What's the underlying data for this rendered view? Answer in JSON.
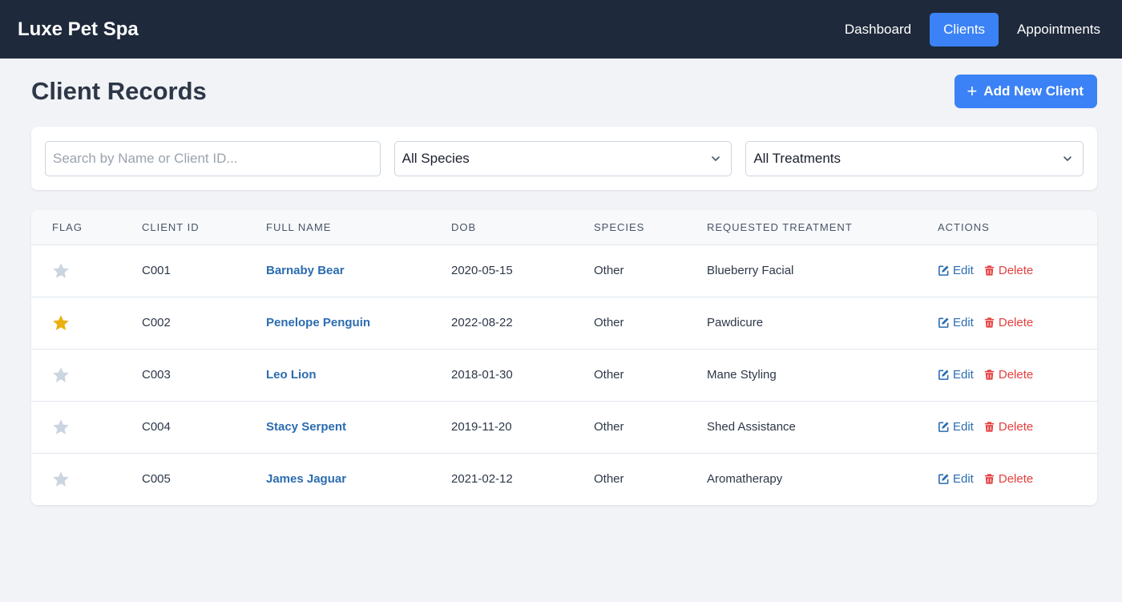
{
  "navbar": {
    "brand": "Luxe Pet Spa",
    "links": [
      {
        "label": "Dashboard",
        "active": false
      },
      {
        "label": "Clients",
        "active": true
      },
      {
        "label": "Appointments",
        "active": false
      }
    ]
  },
  "page": {
    "title": "Client Records",
    "add_button_label": "Add New Client"
  },
  "filters": {
    "search_placeholder": "Search by Name or Client ID...",
    "search_value": "",
    "species_selected": "All Species",
    "treatment_selected": "All Treatments"
  },
  "table": {
    "headers": {
      "flag": "FLAG",
      "client_id": "CLIENT ID",
      "full_name": "FULL NAME",
      "dob": "DOB",
      "species": "SPECIES",
      "treatment": "REQUESTED TREATMENT",
      "actions": "ACTIONS"
    },
    "edit_label": "Edit",
    "delete_label": "Delete",
    "rows": [
      {
        "flagged": false,
        "id": "C001",
        "name": "Barnaby Bear",
        "dob": "2020-05-15",
        "species": "Other",
        "treatment": "Blueberry Facial"
      },
      {
        "flagged": true,
        "id": "C002",
        "name": "Penelope Penguin",
        "dob": "2022-08-22",
        "species": "Other",
        "treatment": "Pawdicure"
      },
      {
        "flagged": false,
        "id": "C003",
        "name": "Leo Lion",
        "dob": "2018-01-30",
        "species": "Other",
        "treatment": "Mane Styling"
      },
      {
        "flagged": false,
        "id": "C004",
        "name": "Stacy Serpent",
        "dob": "2019-11-20",
        "species": "Other",
        "treatment": "Shed Assistance"
      },
      {
        "flagged": false,
        "id": "C005",
        "name": "James Jaguar",
        "dob": "2021-02-12",
        "species": "Other",
        "treatment": "Aromatherapy"
      }
    ]
  },
  "colors": {
    "navbar_bg": "#1e293b",
    "accent": "#3b82f6",
    "link": "#2b6cb0",
    "danger": "#e53e3e",
    "star_active": "#ecb00e",
    "star_inactive": "#cbd5e0"
  },
  "icons": {
    "flag": "star-icon",
    "edit": "edit-icon",
    "delete": "trash-icon",
    "add": "plus-icon",
    "select": "chevron-down-icon"
  }
}
